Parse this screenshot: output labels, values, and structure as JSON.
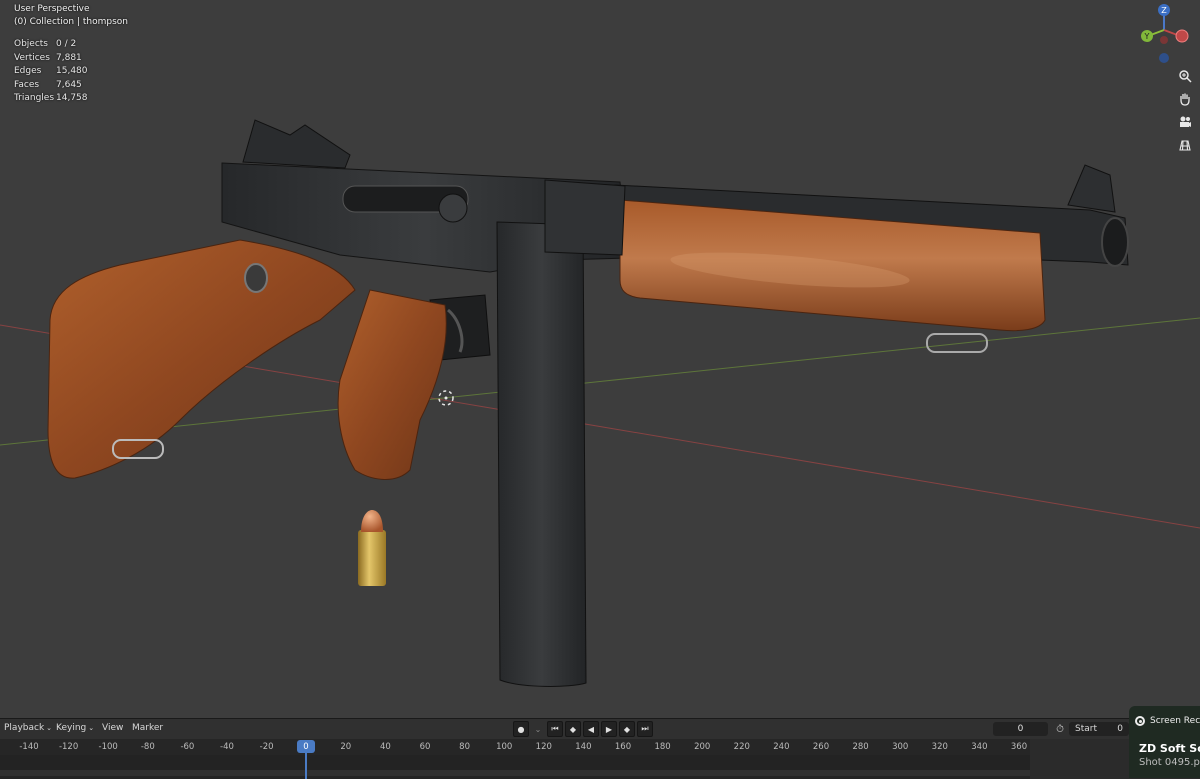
{
  "viewport": {
    "perspective_label": "User Perspective",
    "collection_label": "(0) Collection | thompson",
    "stats": [
      {
        "label": "Objects",
        "value": "0 / 2"
      },
      {
        "label": "Vertices",
        "value": "7,881"
      },
      {
        "label": "Edges",
        "value": "15,480"
      },
      {
        "label": "Faces",
        "value": "7,645"
      },
      {
        "label": "Triangles",
        "value": "14,758"
      }
    ],
    "gizmo": {
      "z_label": "Z",
      "y_label": "Y"
    },
    "nav_icons": [
      "zoom-icon",
      "hand-pan-icon",
      "camera-icon",
      "grid-ortho-icon"
    ]
  },
  "timeline": {
    "menus": {
      "playback": "Playback",
      "keying": "Keying",
      "view": "View",
      "marker": "Marker"
    },
    "current_frame": "0",
    "start_label": "Start",
    "start_value": "0",
    "ruler_ticks": [
      "-140",
      "-120",
      "-100",
      "-80",
      "-60",
      "-40",
      "-20",
      "0",
      "20",
      "40",
      "60",
      "80",
      "100",
      "120",
      "140",
      "160",
      "180",
      "200",
      "220",
      "240",
      "260",
      "280",
      "300",
      "320",
      "340",
      "360"
    ],
    "playhead_frame": "0"
  },
  "popup": {
    "record_label": "Screen Rec",
    "title": "ZD Soft Scre",
    "subtitle": "Shot 0495.p"
  },
  "colors": {
    "viewport_bg": "#3d3d3d",
    "playhead": "#4a7bc4",
    "x_axis": "#b04848",
    "y_axis": "#6b8a3a",
    "wood": "#9c4f24",
    "metal": "#2d2f31"
  }
}
